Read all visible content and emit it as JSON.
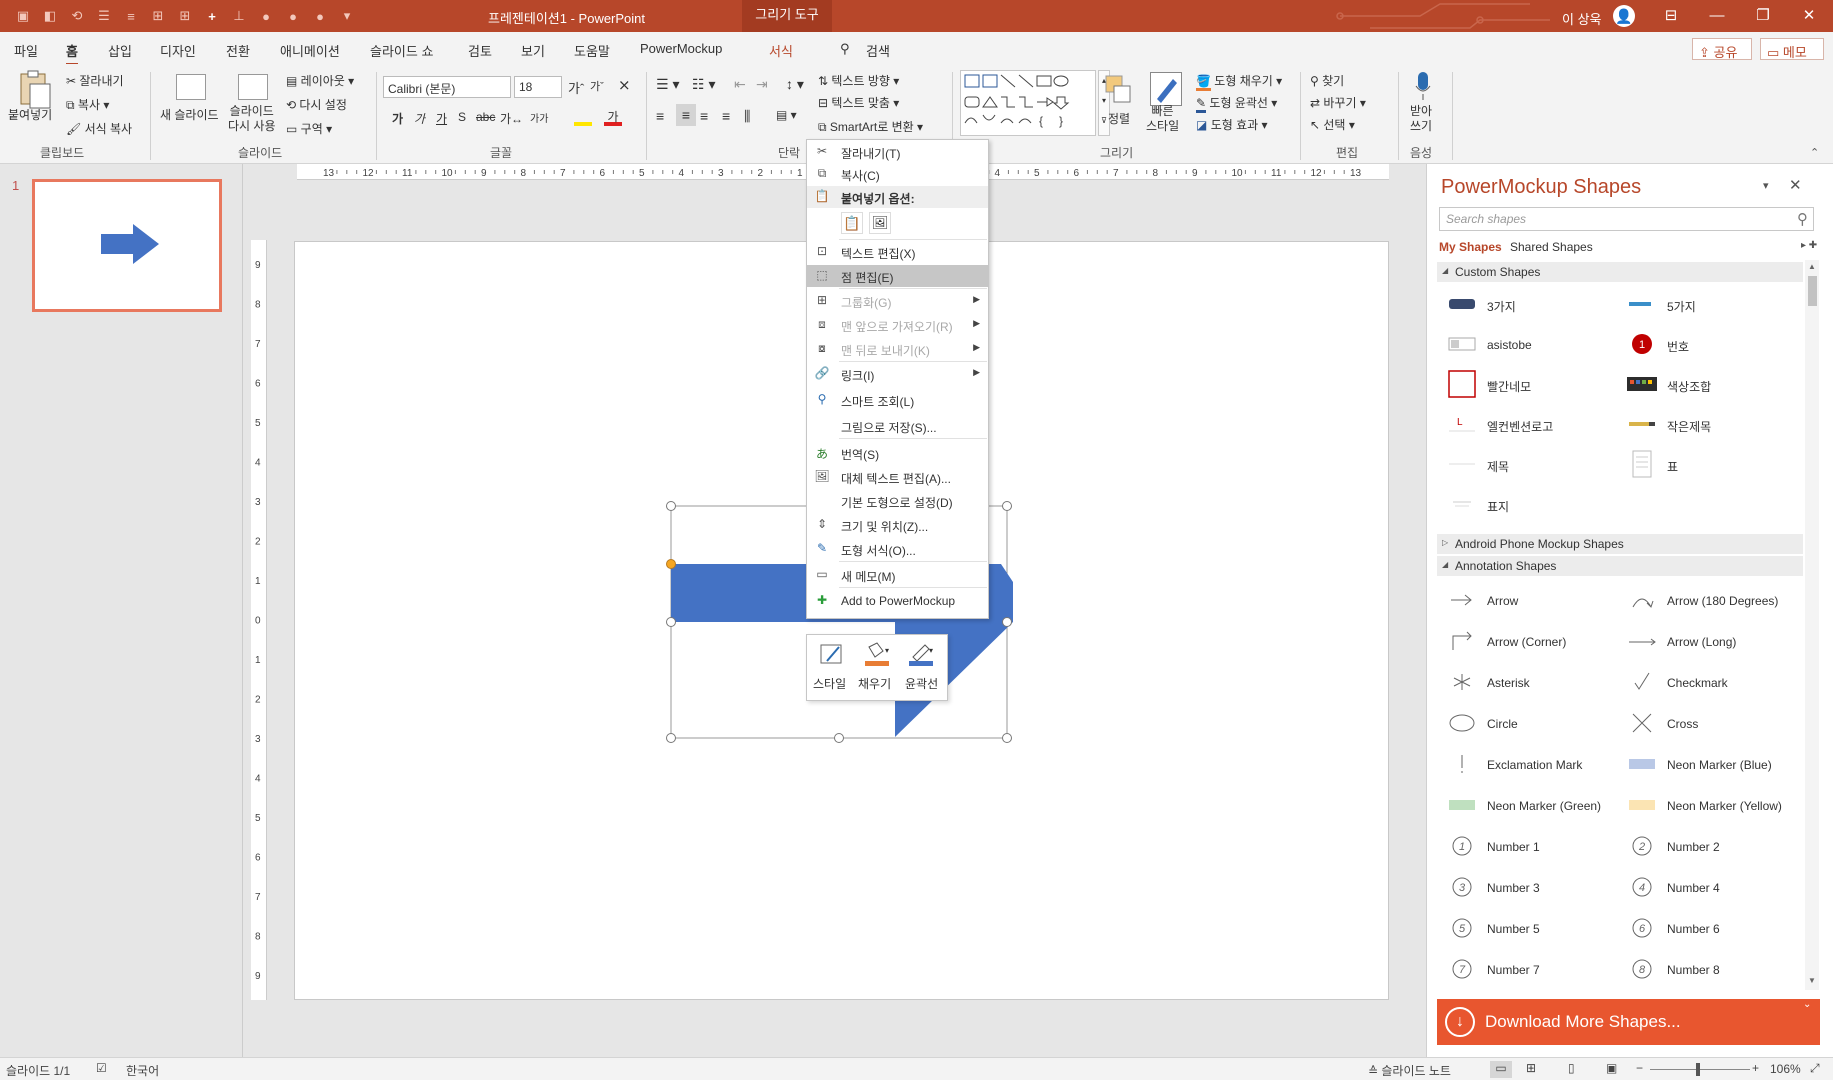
{
  "titlebar": {
    "doc_title": "프레젠테이션1  -  PowerPoint",
    "contextual_tab": "그리기 도구",
    "user": "이 상욱",
    "win_buttons": {
      "restore_panes": "⊟",
      "minimize": "—",
      "maximize": "❐",
      "close": "✕"
    }
  },
  "menu_tabs": [
    "파일",
    "홈",
    "삽입",
    "디자인",
    "전환",
    "애니메이션",
    "슬라이드 쇼",
    "검토",
    "보기",
    "도움말",
    "PowerMockup",
    "서식",
    "검색"
  ],
  "menu_right": {
    "share": "공유",
    "memo": "메모"
  },
  "ribbon": {
    "clipboard": {
      "paste": "붙여넣기",
      "cut": "잘라내기",
      "copy": "복사",
      "format_painter": "서식 복사",
      "label": "클립보드"
    },
    "slides": {
      "new_slide": "새 슬라이드",
      "reuse": "슬라이드\n다시 사용",
      "layout": "레이아웃",
      "reset": "다시 설정",
      "section": "구역",
      "label": "슬라이드"
    },
    "font": {
      "name": "Calibri (본문)",
      "size": "18",
      "label": "글꼴"
    },
    "paragraph": {
      "text_direction": "텍스트 방향",
      "align_text": "텍스트 맞춤",
      "smartart": "SmartArt로 변환",
      "label": "단락"
    },
    "drawing": {
      "arrange": "정렬",
      "quick_styles": "빠른\n스타일",
      "fill": "도형 채우기",
      "outline": "도형 윤곽선",
      "effects": "도형 효과",
      "label": "그리기"
    },
    "editing": {
      "find": "찾기",
      "replace": "바꾸기",
      "select": "선택",
      "label": "편집"
    },
    "voice": {
      "dictate": "받아\n쓰기",
      "label": "음성"
    }
  },
  "thumbnail": {
    "number": "1"
  },
  "hruler_ticks": [
    "13",
    "12",
    "11",
    "10",
    "9",
    "8",
    "7",
    "6",
    "5",
    "4",
    "3",
    "2",
    "1",
    "0",
    "1",
    "2",
    "3",
    "4",
    "5",
    "6",
    "7",
    "8",
    "9",
    "10",
    "11",
    "12",
    "13"
  ],
  "vruler_ticks": [
    "9",
    "8",
    "7",
    "6",
    "5",
    "4",
    "3",
    "2",
    "1",
    "0",
    "1",
    "2",
    "3",
    "4",
    "5",
    "6",
    "7",
    "8",
    "9"
  ],
  "context_menu": {
    "items": [
      {
        "label": "잘라내기(T)",
        "icon": "scissors-icon"
      },
      {
        "label": "복사(C)",
        "icon": "copy-icon"
      },
      {
        "label": "붙여넣기 옵션:",
        "icon": "paste-icon"
      },
      {
        "label": "텍스트 편집(X)",
        "icon": "text-edit-icon"
      },
      {
        "label": "점 편집(E)",
        "icon": "edit-points-icon"
      },
      {
        "label": "그룹화(G)",
        "icon": "group-icon"
      },
      {
        "label": "맨 앞으로 가져오기(R)",
        "icon": "bring-front-icon"
      },
      {
        "label": "맨 뒤로 보내기(K)",
        "icon": "send-back-icon"
      },
      {
        "label": "링크(I)",
        "icon": "link-icon"
      },
      {
        "label": "스마트 조회(L)",
        "icon": "smart-lookup-icon"
      },
      {
        "label": "그림으로 저장(S)...",
        "icon": ""
      },
      {
        "label": "번역(S)",
        "icon": "translate-icon"
      },
      {
        "label": "대체 텍스트 편집(A)...",
        "icon": "alt-text-icon"
      },
      {
        "label": "기본 도형으로 설정(D)",
        "icon": ""
      },
      {
        "label": "크기 및 위치(Z)...",
        "icon": "size-position-icon"
      },
      {
        "label": "도형 서식(O)...",
        "icon": "format-shape-icon"
      },
      {
        "label": "새 메모(M)",
        "icon": "new-comment-icon"
      },
      {
        "label": "Add to PowerMockup",
        "icon": "plus-icon"
      }
    ]
  },
  "mini_toolbar": {
    "style": "스타일",
    "fill": "채우기",
    "outline": "윤곽선"
  },
  "powermockup": {
    "title": "PowerMockup Shapes",
    "search_placeholder": "Search shapes",
    "tab_my": "My Shapes",
    "tab_shared": "Shared Shapes",
    "sections": {
      "custom": "Custom Shapes",
      "android": "Android Phone Mockup Shapes",
      "annotation": "Annotation Shapes"
    },
    "custom_shapes": [
      "3가지",
      "5가지",
      "asistobe",
      "번호",
      "빨간네모",
      "색상조합",
      "엘컨벤션로고",
      "작은제목",
      "제목",
      "표",
      "표지"
    ],
    "annotation_shapes": [
      "Arrow",
      "Arrow (180 Degrees)",
      "Arrow (Corner)",
      "Arrow (Long)",
      "Asterisk",
      "Checkmark",
      "Circle",
      "Cross",
      "Exclamation Mark",
      "Neon Marker (Blue)",
      "Neon Marker (Green)",
      "Neon Marker (Yellow)",
      "Number 1",
      "Number 2",
      "Number 3",
      "Number 4",
      "Number 5",
      "Number 6",
      "Number 7",
      "Number 8"
    ],
    "download": "Download More Shapes..."
  },
  "statusbar": {
    "slide": "슬라이드 1/1",
    "language": "한국어",
    "notes": "슬라이드 노트",
    "zoom": "106%"
  },
  "colors": {
    "accent": "#b7472a",
    "shape_blue": "#4472c4",
    "download_orange": "#e8562f"
  }
}
